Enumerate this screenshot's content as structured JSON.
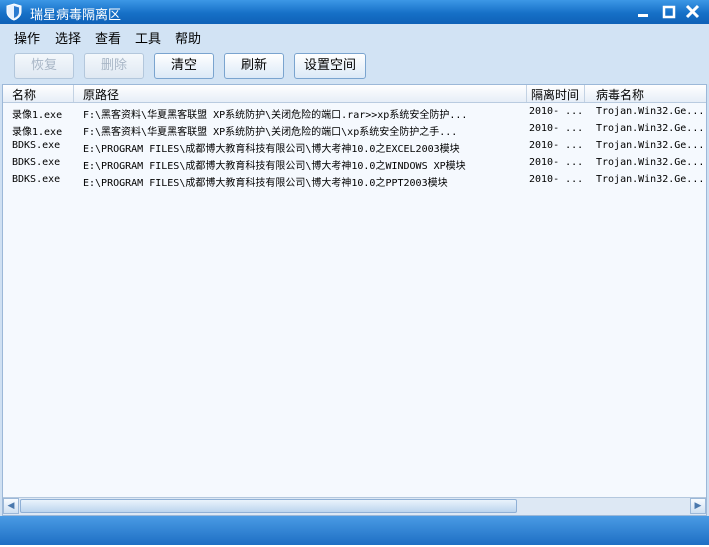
{
  "window": {
    "title": "瑞星病毒隔离区"
  },
  "titlebar": {
    "minimize": "▬",
    "maximize": "□",
    "close": "✕"
  },
  "menu": [
    "操作",
    "选择",
    "查看",
    "工具",
    "帮助"
  ],
  "toolbar": {
    "restore": "恢复",
    "delete": "删除",
    "clear": "清空",
    "refresh": "刷新",
    "set_space": "设置空间"
  },
  "table": {
    "columns": [
      "名称",
      "原路径",
      "隔离时间",
      "病毒名称"
    ],
    "rows": [
      {
        "name": "录像1.exe",
        "path": "F:\\黑客资料\\华夏黑客联盟 XP系统防护\\关闭危险的端口.rar>>xp系统安全防护...",
        "time": "2010- ...",
        "virus": "Trojan.Win32.Ge..."
      },
      {
        "name": "录像1.exe",
        "path": "F:\\黑客资料\\华夏黑客联盟 XP系统防护\\关闭危险的端口\\xp系统安全防护之手...",
        "time": "2010- ...",
        "virus": "Trojan.Win32.Ge..."
      },
      {
        "name": "BDKS.exe",
        "path": "E:\\PROGRAM FILES\\成都博大教育科技有限公司\\博大考神10.0之EXCEL2003模块",
        "time": "2010- ...",
        "virus": "Trojan.Win32.Ge..."
      },
      {
        "name": "BDKS.exe",
        "path": "E:\\PROGRAM FILES\\成都博大教育科技有限公司\\博大考神10.0之WINDOWS XP模块",
        "time": "2010- ...",
        "virus": "Trojan.Win32.Ge..."
      },
      {
        "name": "BDKS.exe",
        "path": "E:\\PROGRAM FILES\\成都博大教育科技有限公司\\博大考神10.0之PPT2003模块",
        "time": "2010- ...",
        "virus": "Trojan.Win32.Ge..."
      }
    ]
  },
  "scrollbar": {
    "left_arrow": "◀",
    "right_arrow": "▶"
  },
  "colors": {
    "titlebar": "#1670c7",
    "accent": "#4a9be4",
    "panel": "#d2e3f4"
  }
}
